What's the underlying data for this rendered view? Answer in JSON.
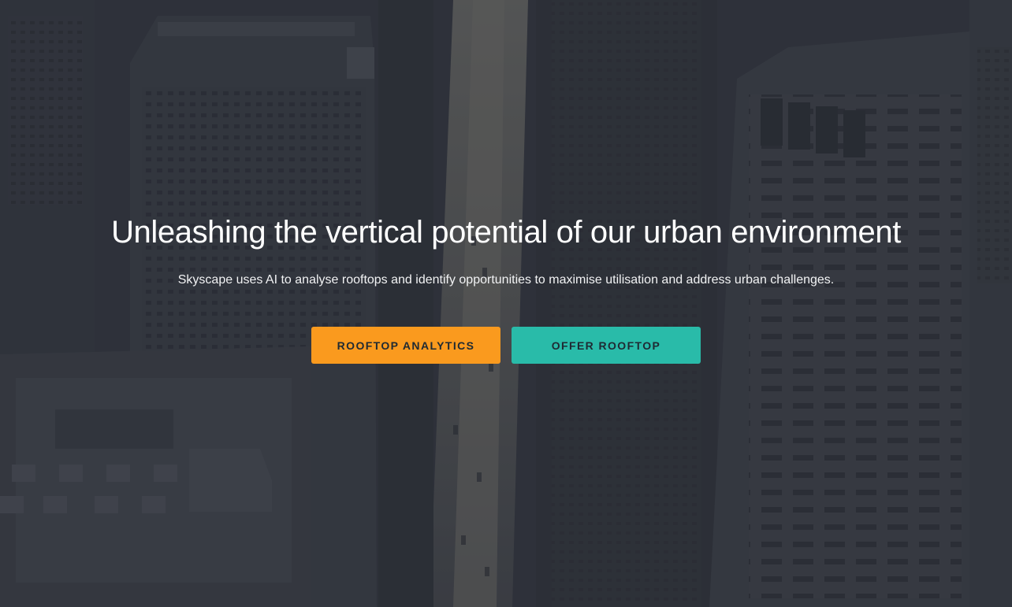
{
  "hero": {
    "title": "Unleashing the vertical potential of our urban environment",
    "subtitle": "Skyscape uses AI to analyse rooftops and identify opportunities to maximise utilisation and address urban challenges."
  },
  "buttons": {
    "primary_label": "ROOFTOP ANALYTICS",
    "secondary_label": "OFFER ROOFTOP"
  },
  "colors": {
    "primary_button": "#fa9a1e",
    "secondary_button": "#29bba9",
    "background_overlay": "#2f333b"
  },
  "background_image": "aerial-city-skyscrapers"
}
